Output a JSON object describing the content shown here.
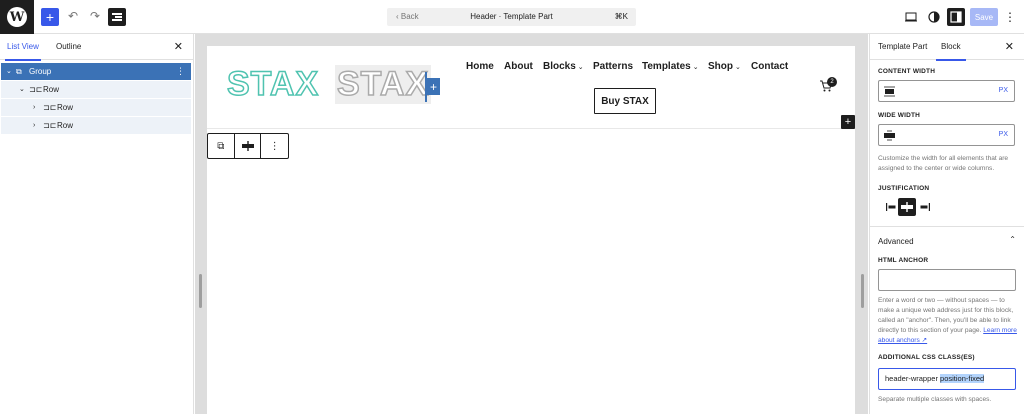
{
  "topbar": {
    "back_label": "‹  Back",
    "doc_title": "Header · Template Part",
    "shortcut": "⌘K",
    "save_label": "Save"
  },
  "left_panel": {
    "tabs": [
      {
        "label": "List View",
        "active": true
      },
      {
        "label": "Outline",
        "active": false
      }
    ],
    "tree": [
      {
        "label": "Group",
        "level": 0,
        "selected": true
      },
      {
        "label": "Row",
        "level": 1,
        "selected": false
      },
      {
        "label": "Row",
        "level": 2,
        "selected": false
      },
      {
        "label": "Row",
        "level": 2,
        "selected": false
      }
    ]
  },
  "canvas": {
    "logo_primary": "STAX",
    "logo_secondary": "STAX",
    "nav": [
      {
        "label": "Home",
        "dropdown": false
      },
      {
        "label": "About",
        "dropdown": false
      },
      {
        "label": "Blocks",
        "dropdown": true
      },
      {
        "label": "Patterns",
        "dropdown": false
      },
      {
        "label": "Templates",
        "dropdown": true
      },
      {
        "label": "Shop",
        "dropdown": true
      },
      {
        "label": "Contact",
        "dropdown": false
      }
    ],
    "buy_button": "Buy STAX",
    "cart_count": "2"
  },
  "right_panel": {
    "tabs": [
      {
        "label": "Template Part",
        "active": false
      },
      {
        "label": "Block",
        "active": true
      }
    ],
    "content_width_label": "CONTENT WIDTH",
    "content_width_unit": "PX",
    "wide_width_label": "WIDE WIDTH",
    "wide_width_unit": "PX",
    "width_help": "Customize the width for all elements that are assigned to the center or wide columns.",
    "justification_label": "JUSTIFICATION",
    "advanced_label": "Advanced",
    "html_anchor_label": "HTML ANCHOR",
    "html_anchor_value": "",
    "anchor_help": "Enter a word or two — without spaces — to make a unique web address just for this block, called an \"anchor\". Then, you'll be able to link directly to this section of your page.",
    "anchor_link": "Learn more about anchors ↗",
    "css_class_label": "ADDITIONAL CSS CLASS(ES)",
    "css_class_plain": "header-wrapper ",
    "css_class_selected": "position-fixed",
    "css_help": "Separate multiple classes with spaces."
  },
  "colors": {
    "accent": "#3858e9",
    "selection": "#3b72b6",
    "logo_teal": "#4fc3b0"
  }
}
